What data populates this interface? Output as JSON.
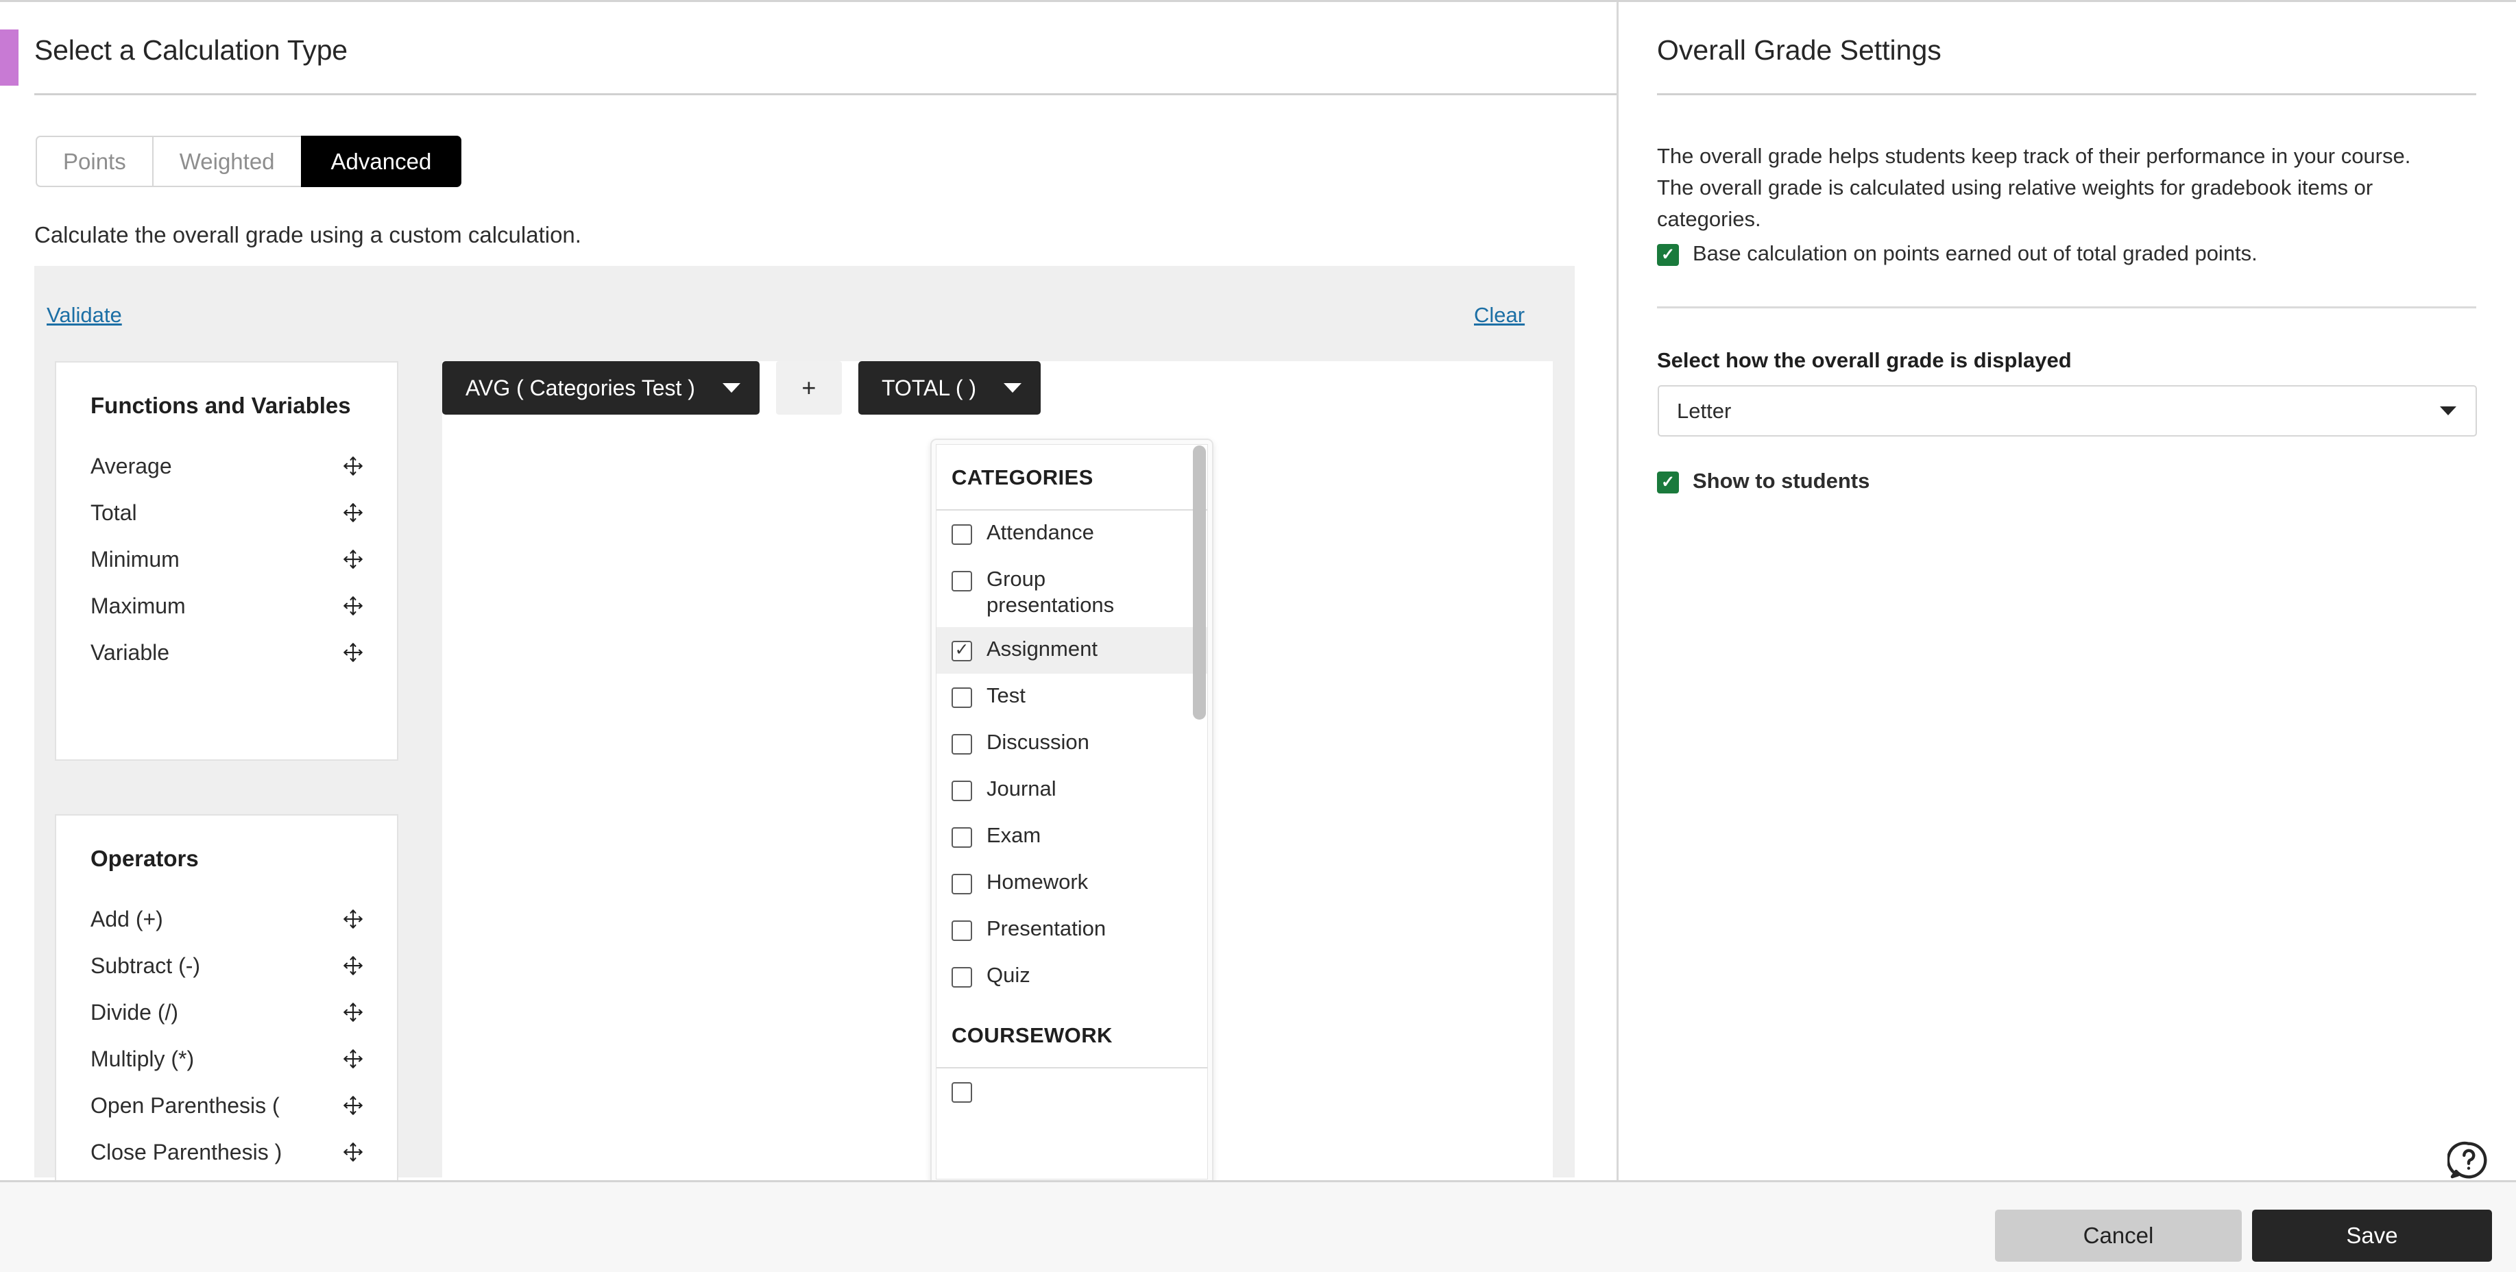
{
  "left": {
    "title": "Select a Calculation Type",
    "tabs": [
      {
        "label": "Points",
        "active": false
      },
      {
        "label": "Weighted",
        "active": false
      },
      {
        "label": "Advanced",
        "active": true
      }
    ],
    "subtitle": "Calculate the overall grade using a custom calculation.",
    "validate_link": "Validate",
    "clear_link": "Clear",
    "functions_card": {
      "heading": "Functions and Variables",
      "items": [
        "Average",
        "Total",
        "Minimum",
        "Maximum",
        "Variable"
      ]
    },
    "operators_card": {
      "heading": "Operators",
      "items": [
        "Add (+)",
        "Subtract (-)",
        "Divide (/)",
        "Multiply (*)",
        "Open Parenthesis (",
        "Close Parenthesis )"
      ]
    },
    "formula_tokens": [
      {
        "label": "AVG ( Categories Test )",
        "type": "function"
      },
      {
        "label": "+",
        "type": "operator"
      },
      {
        "label": "TOTAL ( )",
        "type": "function"
      }
    ],
    "dropdown": {
      "group1_header": "CATEGORIES",
      "group1_items": [
        {
          "label": "Attendance",
          "checked": false,
          "highlighted": false
        },
        {
          "label": "Group presentations",
          "checked": false,
          "highlighted": false
        },
        {
          "label": "Assignment",
          "checked": true,
          "highlighted": true
        },
        {
          "label": "Test",
          "checked": false,
          "highlighted": false
        },
        {
          "label": "Discussion",
          "checked": false,
          "highlighted": false
        },
        {
          "label": "Journal",
          "checked": false,
          "highlighted": false
        },
        {
          "label": "Exam",
          "checked": false,
          "highlighted": false
        },
        {
          "label": "Homework",
          "checked": false,
          "highlighted": false
        },
        {
          "label": "Presentation",
          "checked": false,
          "highlighted": false
        },
        {
          "label": "Quiz",
          "checked": false,
          "highlighted": false
        }
      ],
      "group2_header": "COURSEWORK"
    }
  },
  "right": {
    "title": "Overall Grade Settings",
    "description": "The overall grade helps students keep track of their performance in your course. The overall grade is calculated using relative weights for gradebook items or categories.",
    "base_calculation_label": "Base calculation on points earned out of total graded points.",
    "base_calculation_checked": true,
    "display_field_label": "Select how the overall grade is displayed",
    "display_value": "Letter",
    "show_to_students_label": "Show to students",
    "show_to_students_checked": true
  },
  "footer": {
    "cancel_label": "Cancel",
    "save_label": "Save"
  },
  "colors": {
    "accent_purple": "#c87ad4",
    "link_blue": "#1c6fa5",
    "check_green": "#1a7a3c",
    "token_dark": "#262626"
  }
}
